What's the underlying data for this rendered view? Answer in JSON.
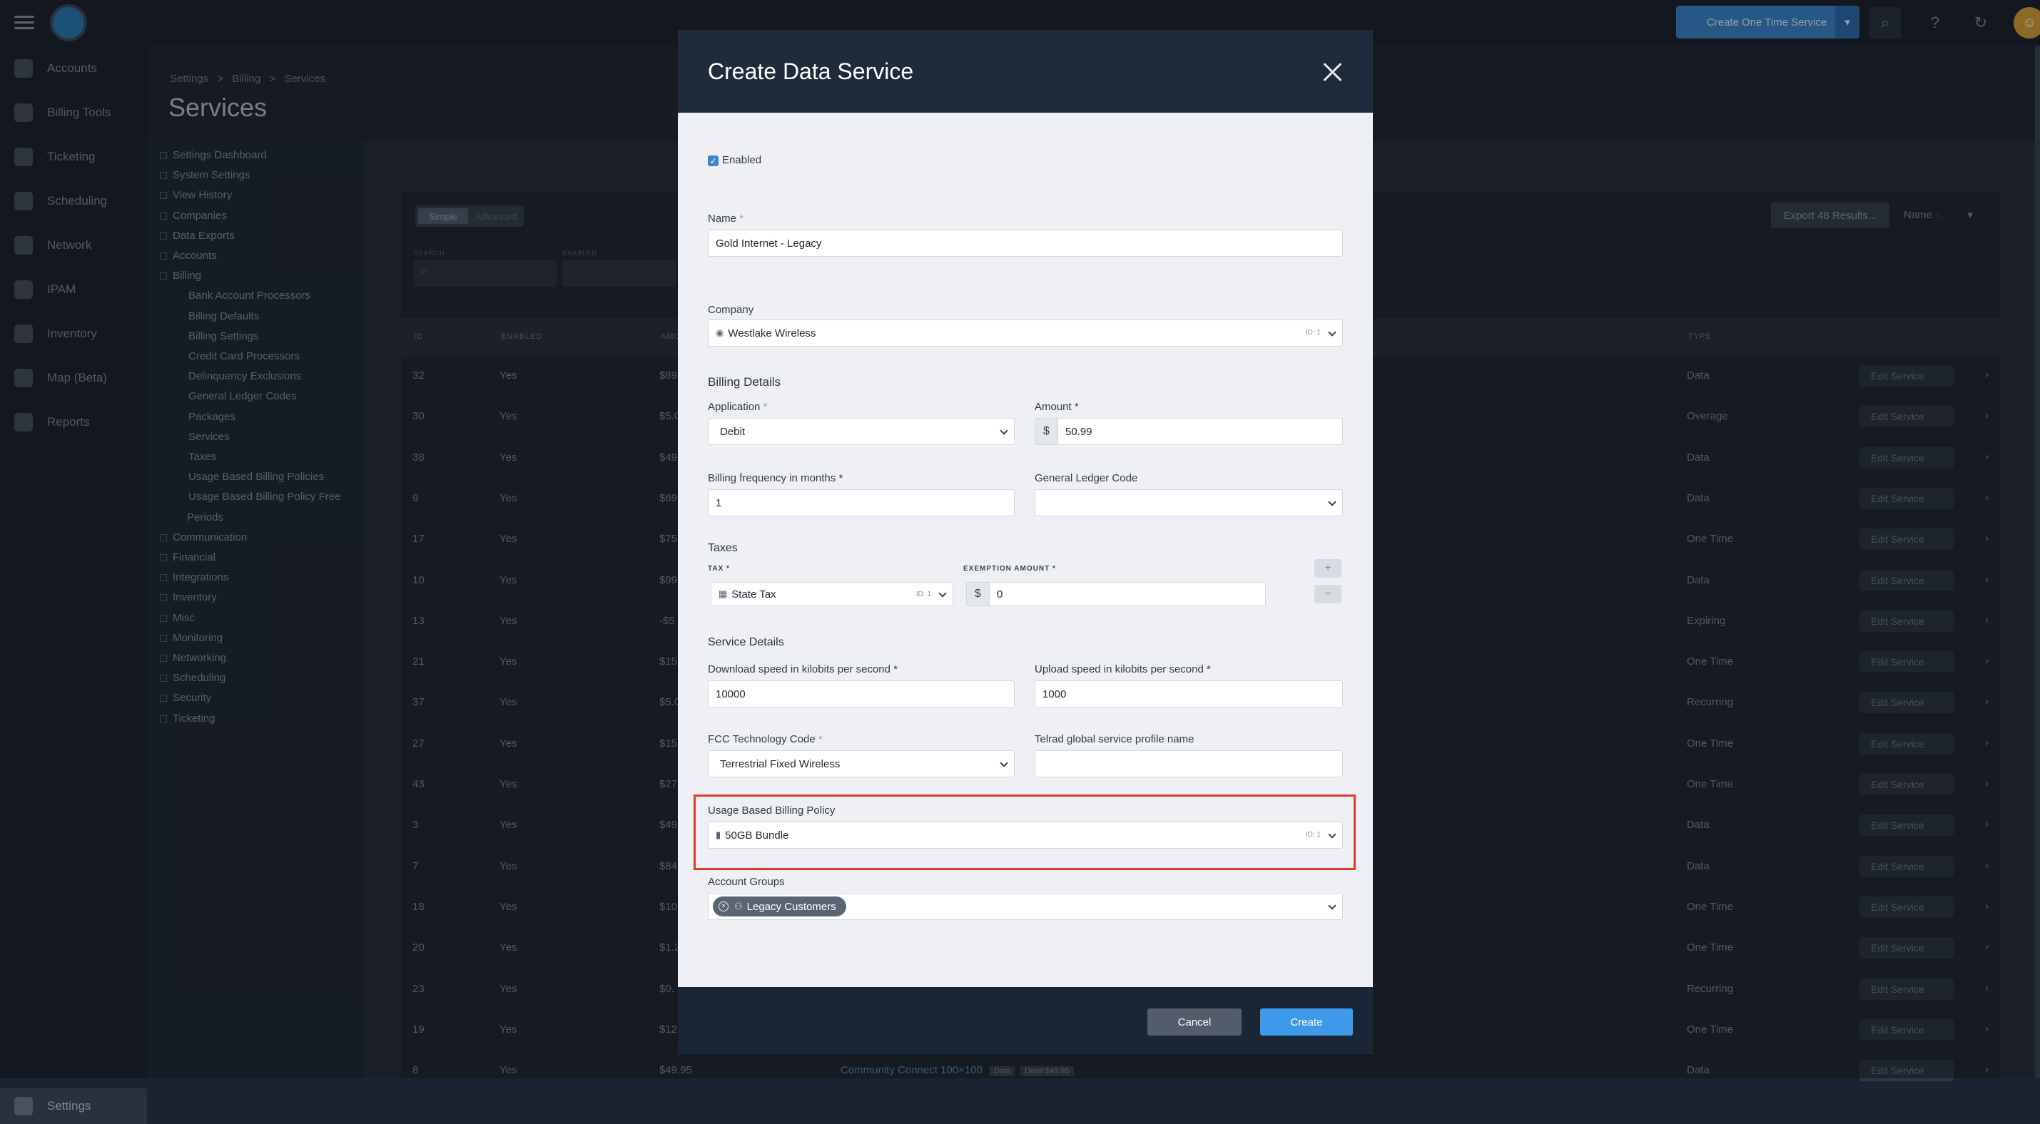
{
  "topbar": {
    "primary_action": "Create One Time Service"
  },
  "rail": {
    "items": [
      "Accounts",
      "Billing Tools",
      "Ticketing",
      "Scheduling",
      "Network",
      "IPAM",
      "Inventory",
      "Map (Beta)",
      "Reports"
    ],
    "bottom": "Settings"
  },
  "header": {
    "breadcrumb": [
      "Settings",
      "Billing",
      "Services"
    ],
    "breadcrumb_sep": ">",
    "title": "Services"
  },
  "settings_nav": [
    {
      "label": "Settings Dashboard",
      "level": 0
    },
    {
      "label": "System Settings",
      "level": 0
    },
    {
      "label": "View History",
      "level": 0
    },
    {
      "label": "Companies",
      "level": 0
    },
    {
      "label": "Data Exports",
      "level": 0
    },
    {
      "label": "Accounts",
      "level": 0
    },
    {
      "label": "Billing",
      "level": 0
    },
    {
      "label": "Bank Account Processors",
      "level": 1
    },
    {
      "label": "Billing Defaults",
      "level": 1
    },
    {
      "label": "Billing Settings",
      "level": 1
    },
    {
      "label": "Credit Card Processors",
      "level": 1
    },
    {
      "label": "Delinquency Exclusions",
      "level": 1
    },
    {
      "label": "General Ledger Codes",
      "level": 1
    },
    {
      "label": "Packages",
      "level": 1
    },
    {
      "label": "Services",
      "level": 1
    },
    {
      "label": "Taxes",
      "level": 1
    },
    {
      "label": "Usage Based Billing Policies",
      "level": 1
    },
    {
      "label": "Usage Based Billing Policy Free",
      "level": 1
    },
    {
      "label": "Periods",
      "level": 2
    },
    {
      "label": "Communication",
      "level": 0
    },
    {
      "label": "Financial",
      "level": 0
    },
    {
      "label": "Integrations",
      "level": 0
    },
    {
      "label": "Inventory",
      "level": 0
    },
    {
      "label": "Misc",
      "level": 0
    },
    {
      "label": "Monitoring",
      "level": 0
    },
    {
      "label": "Networking",
      "level": 0
    },
    {
      "label": "Scheduling",
      "level": 0
    },
    {
      "label": "Security",
      "level": 0
    },
    {
      "label": "Ticketing",
      "level": 0
    }
  ],
  "table": {
    "tabs": [
      "Simple",
      "Advanced"
    ],
    "filters": [
      "SEARCH",
      "ENABLED"
    ],
    "export_label": "Export 48 Results...",
    "sort_label": "Name",
    "sort_hint": "↑↓",
    "columns": [
      "ID",
      "ENABLED",
      "AMO",
      "TYPE"
    ],
    "edit_label": "Edit Service",
    "rows": [
      {
        "id": "32",
        "enabled": "Yes",
        "amount": "$89",
        "type": "Data"
      },
      {
        "id": "30",
        "enabled": "Yes",
        "amount": "$5.0",
        "type": "Overage"
      },
      {
        "id": "38",
        "enabled": "Yes",
        "amount": "$49",
        "type": "Data"
      },
      {
        "id": "9",
        "enabled": "Yes",
        "amount": "$69",
        "type": "Data"
      },
      {
        "id": "17",
        "enabled": "Yes",
        "amount": "$75",
        "type": "One Time"
      },
      {
        "id": "10",
        "enabled": "Yes",
        "amount": "$99",
        "type": "Data"
      },
      {
        "id": "13",
        "enabled": "Yes",
        "amount": "-$5",
        "type": "Expiring"
      },
      {
        "id": "21",
        "enabled": "Yes",
        "amount": "$15",
        "type": "One Time"
      },
      {
        "id": "37",
        "enabled": "Yes",
        "amount": "$5.0",
        "type": "Recurring"
      },
      {
        "id": "27",
        "enabled": "Yes",
        "amount": "$15",
        "type": "One Time"
      },
      {
        "id": "43",
        "enabled": "Yes",
        "amount": "$27",
        "type": "One Time"
      },
      {
        "id": "3",
        "enabled": "Yes",
        "amount": "$49",
        "type": "Data"
      },
      {
        "id": "7",
        "enabled": "Yes",
        "amount": "$84",
        "type": "Data"
      },
      {
        "id": "18",
        "enabled": "Yes",
        "amount": "$10",
        "type": "One Time"
      },
      {
        "id": "20",
        "enabled": "Yes",
        "amount": "$1.2",
        "type": "One Time"
      },
      {
        "id": "23",
        "enabled": "Yes",
        "amount": "$0.",
        "type": "Recurring"
      },
      {
        "id": "19",
        "enabled": "Yes",
        "amount": "$12",
        "type": "One Time"
      },
      {
        "id": "8",
        "enabled": "Yes",
        "amount": "$49.95",
        "type": "Data"
      }
    ],
    "last_row_extra": "Community Connect 100×100",
    "last_row_badge": "Data",
    "last_row_note": "Debit $49.95"
  },
  "modal": {
    "title": "Create Data Service",
    "enabled_label": "Enabled",
    "name_label": "Name",
    "name_value": "Gold Internet - Legacy",
    "company_label": "Company",
    "company_value": "Westlake Wireless",
    "company_id": "ID: 1",
    "billing_details": "Billing Details",
    "application_label": "Application",
    "application_value": "Debit",
    "amount_label": "Amount",
    "amount_prefix": "$",
    "amount_value": "50.99",
    "billing_freq_label": "Billing frequency in months",
    "billing_freq_value": "1",
    "gl_code_label": "General Ledger Code",
    "taxes_label": "Taxes",
    "tax_col": "TAX",
    "exemption_col": "EXEMPTION AMOUNT",
    "tax_value": "State Tax",
    "tax_id": "ID: 1",
    "exemption_prefix": "$",
    "exemption_value": "0",
    "add_symbol": "+",
    "remove_symbol": "−",
    "service_details": "Service Details",
    "download_label": "Download speed in kilobits per second",
    "download_value": "10000",
    "upload_label": "Upload speed in kilobits per second",
    "upload_value": "1000",
    "fcc_label": "FCC Technology Code",
    "fcc_value": "Terrestrial Fixed Wireless",
    "telrad_label": "Telrad global service profile name",
    "ubb_label": "Usage Based Billing Policy",
    "ubb_value": "50GB Bundle",
    "ubb_id": "ID: 1",
    "groups_label": "Account Groups",
    "group_tag": "Legacy Customers",
    "cancel_label": "Cancel",
    "create_label": "Create",
    "required_mark": "*"
  },
  "colors": {
    "accent": "#3e9ae9",
    "highlight": "#e03b2a",
    "modal_header": "#1f2b3b"
  }
}
